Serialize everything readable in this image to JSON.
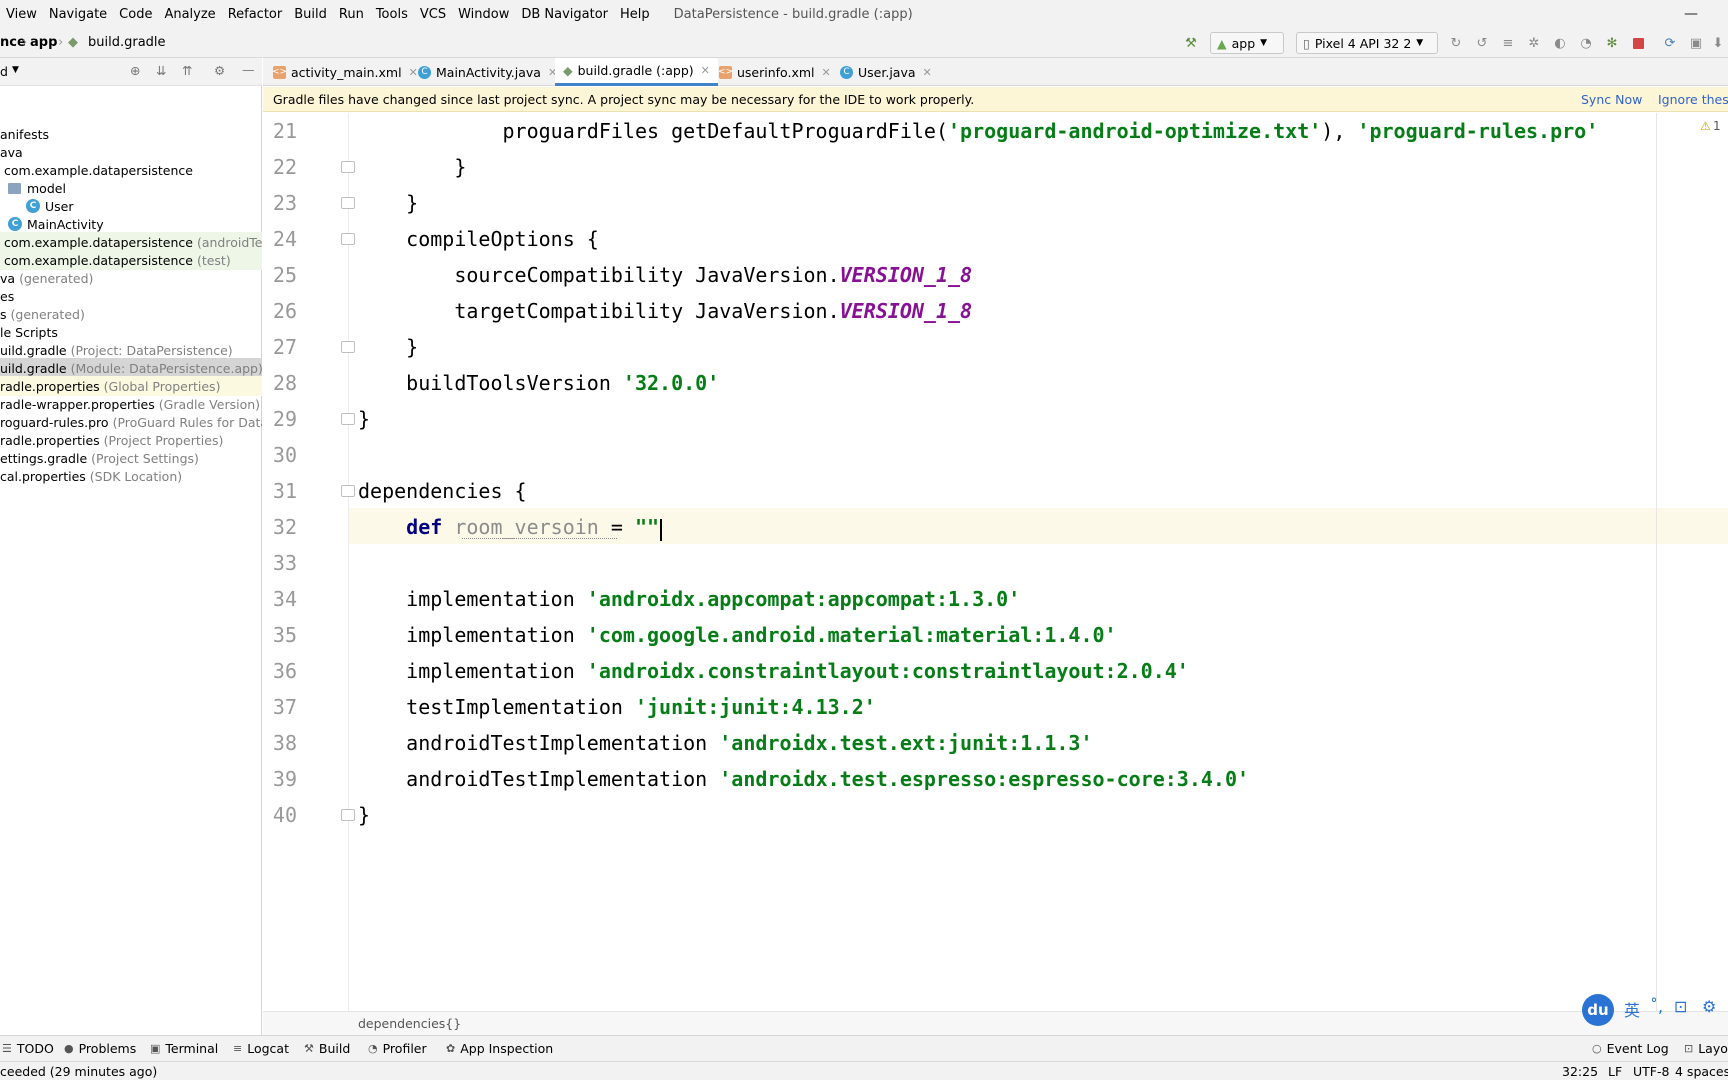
{
  "menu": [
    "View",
    "Navigate",
    "Code",
    "Analyze",
    "Refactor",
    "Build",
    "Run",
    "Tools",
    "VCS",
    "Window",
    "DB Navigator",
    "Help"
  ],
  "window_title": "DataPersistence - build.gradle (:app)",
  "breadcrumb": {
    "part1": "nce",
    "part2": "app",
    "part3": "build.gradle"
  },
  "run_config": "app",
  "device": "Pixel 4 API 32 2",
  "project_header": "d",
  "tree": [
    {
      "label": "anifests",
      "note": ""
    },
    {
      "label": "ava",
      "note": ""
    },
    {
      "label": "com.example.datapersistence",
      "note": ""
    },
    {
      "label": "model",
      "note": ""
    },
    {
      "label": "User",
      "note": ""
    },
    {
      "label": "MainActivity",
      "note": ""
    },
    {
      "label": "com.example.datapersistence",
      "note": "(androidTest)"
    },
    {
      "label": "com.example.datapersistence",
      "note": "(test)"
    },
    {
      "label": "va",
      "note": "(generated)"
    },
    {
      "label": "es",
      "note": ""
    },
    {
      "label": "s",
      "note": "(generated)"
    },
    {
      "label": "le Scripts",
      "note": ""
    },
    {
      "label": "uild.gradle",
      "note": "(Project: DataPersistence)"
    },
    {
      "label": "uild.gradle",
      "note": "(Module: DataPersistence.app)"
    },
    {
      "label": "radle.properties",
      "note": "(Global Properties)"
    },
    {
      "label": "radle-wrapper.properties",
      "note": "(Gradle Version)"
    },
    {
      "label": "roguard-rules.pro",
      "note": "(ProGuard Rules for DataPe"
    },
    {
      "label": "radle.properties",
      "note": "(Project Properties)"
    },
    {
      "label": "ettings.gradle",
      "note": "(Project Settings)"
    },
    {
      "label": "cal.properties",
      "note": "(SDK Location)"
    }
  ],
  "tabs": [
    "activity_main.xml",
    "MainActivity.java",
    "build.gradle (:app)",
    "userinfo.xml",
    "User.java"
  ],
  "banner": {
    "message": "Gradle files have changed since last project sync. A project sync may be necessary for the IDE to work properly.",
    "sync": "Sync Now",
    "ignore": "Ignore these"
  },
  "warning_count": "1",
  "code_lines": [
    {
      "n": "21",
      "parts": [
        {
          "t": "            proguardFiles getDefaultProguardFile(",
          "c": ""
        },
        {
          "t": "'proguard-android-optimize.txt'",
          "c": "str"
        },
        {
          "t": "), ",
          "c": ""
        },
        {
          "t": "'proguard-rules.pro'",
          "c": "str"
        }
      ]
    },
    {
      "n": "22",
      "parts": [
        {
          "t": "        }",
          "c": ""
        }
      ]
    },
    {
      "n": "23",
      "parts": [
        {
          "t": "    }",
          "c": ""
        }
      ]
    },
    {
      "n": "24",
      "parts": [
        {
          "t": "    compileOptions {",
          "c": ""
        }
      ]
    },
    {
      "n": "25",
      "parts": [
        {
          "t": "        sourceCompatibility JavaVersion.",
          "c": ""
        },
        {
          "t": "VERSION_1_8",
          "c": "const"
        }
      ]
    },
    {
      "n": "26",
      "parts": [
        {
          "t": "        targetCompatibility JavaVersion.",
          "c": ""
        },
        {
          "t": "VERSION_1_8",
          "c": "const"
        }
      ]
    },
    {
      "n": "27",
      "parts": [
        {
          "t": "    }",
          "c": ""
        }
      ]
    },
    {
      "n": "28",
      "parts": [
        {
          "t": "    buildToolsVersion ",
          "c": ""
        },
        {
          "t": "'32.0.0'",
          "c": "str"
        }
      ]
    },
    {
      "n": "29",
      "parts": [
        {
          "t": "}",
          "c": ""
        }
      ]
    },
    {
      "n": "30",
      "parts": []
    },
    {
      "n": "31",
      "parts": [
        {
          "t": "dependencies {",
          "c": ""
        }
      ]
    },
    {
      "n": "32",
      "parts": [
        {
          "t": "    ",
          "c": ""
        },
        {
          "t": "def",
          "c": "kw"
        },
        {
          "t": " ",
          "c": ""
        },
        {
          "t": "room_versoin",
          "c": "unused"
        },
        {
          "t": " = ",
          "c": ""
        },
        {
          "t": "\"\"",
          "c": "str"
        }
      ]
    },
    {
      "n": "33",
      "parts": []
    },
    {
      "n": "34",
      "parts": [
        {
          "t": "    implementation ",
          "c": ""
        },
        {
          "t": "'androidx.appcompat:appcompat:1.3.0'",
          "c": "str"
        }
      ]
    },
    {
      "n": "35",
      "parts": [
        {
          "t": "    implementation ",
          "c": ""
        },
        {
          "t": "'com.google.android.material:material:1.4.0'",
          "c": "str"
        }
      ]
    },
    {
      "n": "36",
      "parts": [
        {
          "t": "    implementation ",
          "c": ""
        },
        {
          "t": "'androidx.constraintlayout:constraintlayout:2.0.4'",
          "c": "str"
        }
      ]
    },
    {
      "n": "37",
      "parts": [
        {
          "t": "    testImplementation ",
          "c": ""
        },
        {
          "t": "'junit:junit:4.13.2'",
          "c": "str"
        }
      ]
    },
    {
      "n": "38",
      "parts": [
        {
          "t": "    androidTestImplementation ",
          "c": ""
        },
        {
          "t": "'androidx.test.ext:junit:1.1.3'",
          "c": "str"
        }
      ]
    },
    {
      "n": "39",
      "parts": [
        {
          "t": "    androidTestImplementation ",
          "c": ""
        },
        {
          "t": "'androidx.test.espresso:espresso-core:3.4.0'",
          "c": "str"
        }
      ]
    },
    {
      "n": "40",
      "parts": [
        {
          "t": "}",
          "c": ""
        }
      ]
    }
  ],
  "editor_breadcrumb": "dependencies{}",
  "tool_windows": [
    "TODO",
    "Problems",
    "Terminal",
    "Logcat",
    "Build",
    "Profiler",
    "App Inspection"
  ],
  "right_tools": [
    "Event Log",
    "Layou"
  ],
  "status": {
    "message": "ceeded (29 minutes ago)",
    "position": "32:25",
    "line_sep": "LF",
    "encoding": "UTF-8",
    "indent": "4 spaces"
  },
  "ime": {
    "badge": "du",
    "lang": "英"
  }
}
